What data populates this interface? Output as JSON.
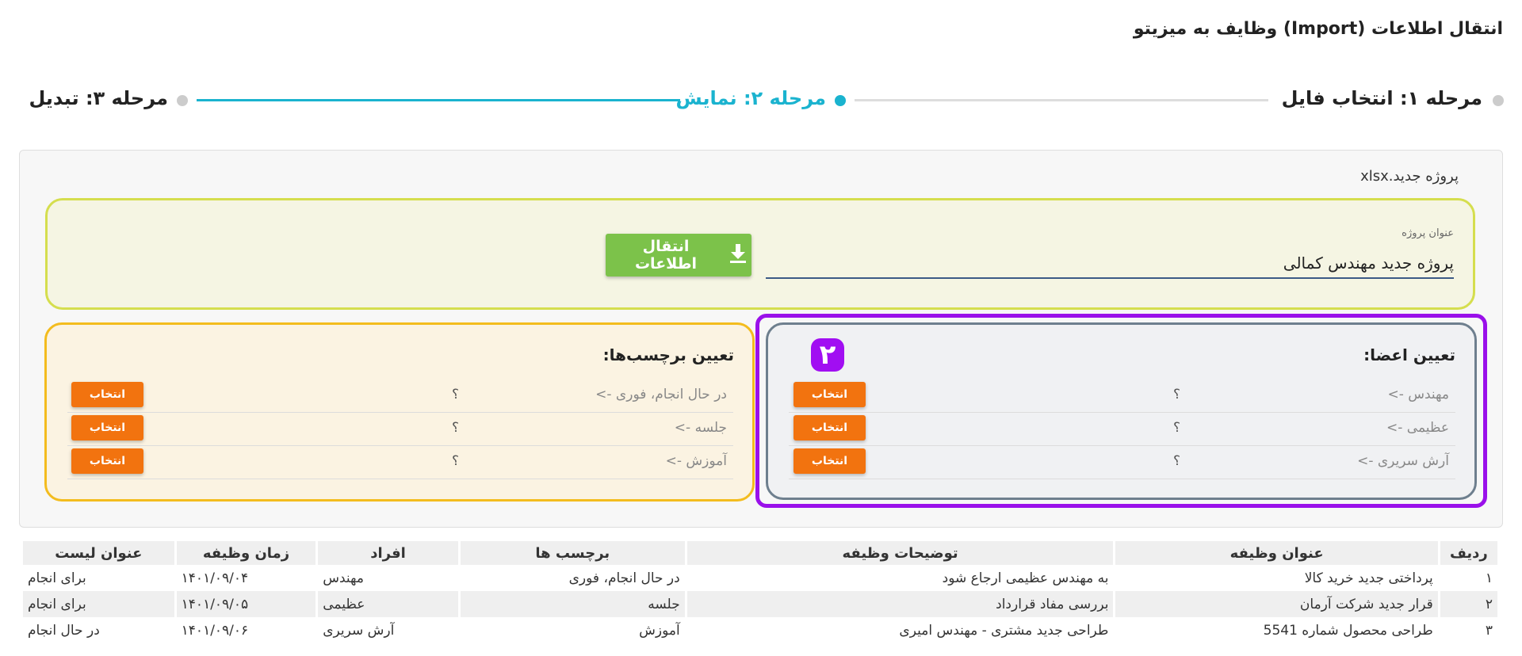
{
  "page": {
    "title": "انتقال اطلاعات (Import) وظایف به میزیتو"
  },
  "stepper": {
    "steps": [
      {
        "label": "مرحله ۱: انتخاب فایل",
        "state": "done"
      },
      {
        "label": "مرحله ۲: نمایش",
        "state": "active"
      },
      {
        "label": "مرحله ۳: تبدیل",
        "state": "pending"
      }
    ],
    "colors": {
      "active": "#1ab3cf",
      "inactive": "#cccccc"
    }
  },
  "file": {
    "name": "پروژه جدید.xlsx"
  },
  "project": {
    "label": "عنوان پروژه",
    "value": "پروژه جدید مهندس کمالی",
    "import_button": "انتقال اطلاعات",
    "import_icon": "download-icon"
  },
  "members": {
    "title": "تعیین اعضا:",
    "badge": "۲",
    "rows": [
      {
        "source": "مهندس ->",
        "target": "؟",
        "button": "انتخاب"
      },
      {
        "source": "عظیمی ->",
        "target": "؟",
        "button": "انتخاب"
      },
      {
        "source": "آرش سریری ->",
        "target": "؟",
        "button": "انتخاب"
      }
    ]
  },
  "tags": {
    "title": "تعیین برچسب‌ها:",
    "rows": [
      {
        "source": "در حال انجام، فوری ->",
        "target": "؟",
        "button": "انتخاب"
      },
      {
        "source": "جلسه ->",
        "target": "؟",
        "button": "انتخاب"
      },
      {
        "source": "آموزش ->",
        "target": "؟",
        "button": "انتخاب"
      }
    ]
  },
  "table": {
    "headers": [
      "ردیف",
      "عنوان وظیفه",
      "توضیحات وظیفه",
      "برچسب ها",
      "افراد",
      "زمان وظیفه",
      "عنوان لیست"
    ],
    "rows": [
      [
        "۱",
        "پرداختی جدید خرید کالا",
        "به مهندس عظیمی ارجاع شود",
        "در حال انجام، فوری",
        "مهندس",
        "۱۴۰۱/۰۹/۰۴",
        "برای انجام"
      ],
      [
        "۲",
        "قرار جدید شرکت آرمان",
        "بررسی مفاد قرارداد",
        "جلسه",
        "عظیمی",
        "۱۴۰۱/۰۹/۰۵",
        "برای انجام"
      ],
      [
        "۳",
        "طراحی محصول شماره 5541",
        "طراحی جدید مشتری - مهندس امیری",
        "آموزش",
        "آرش سریری",
        "۱۴۰۱/۰۹/۰۶",
        "در حال انجام"
      ]
    ]
  },
  "colors": {
    "accent": "#1ab3cf",
    "import_button": "#7cc24a",
    "select_button": "#f2730f",
    "highlight": "#9a10ea",
    "project_border": "#d5de4e",
    "tags_border": "#f3bc1e",
    "members_border": "#6e7f8e"
  }
}
